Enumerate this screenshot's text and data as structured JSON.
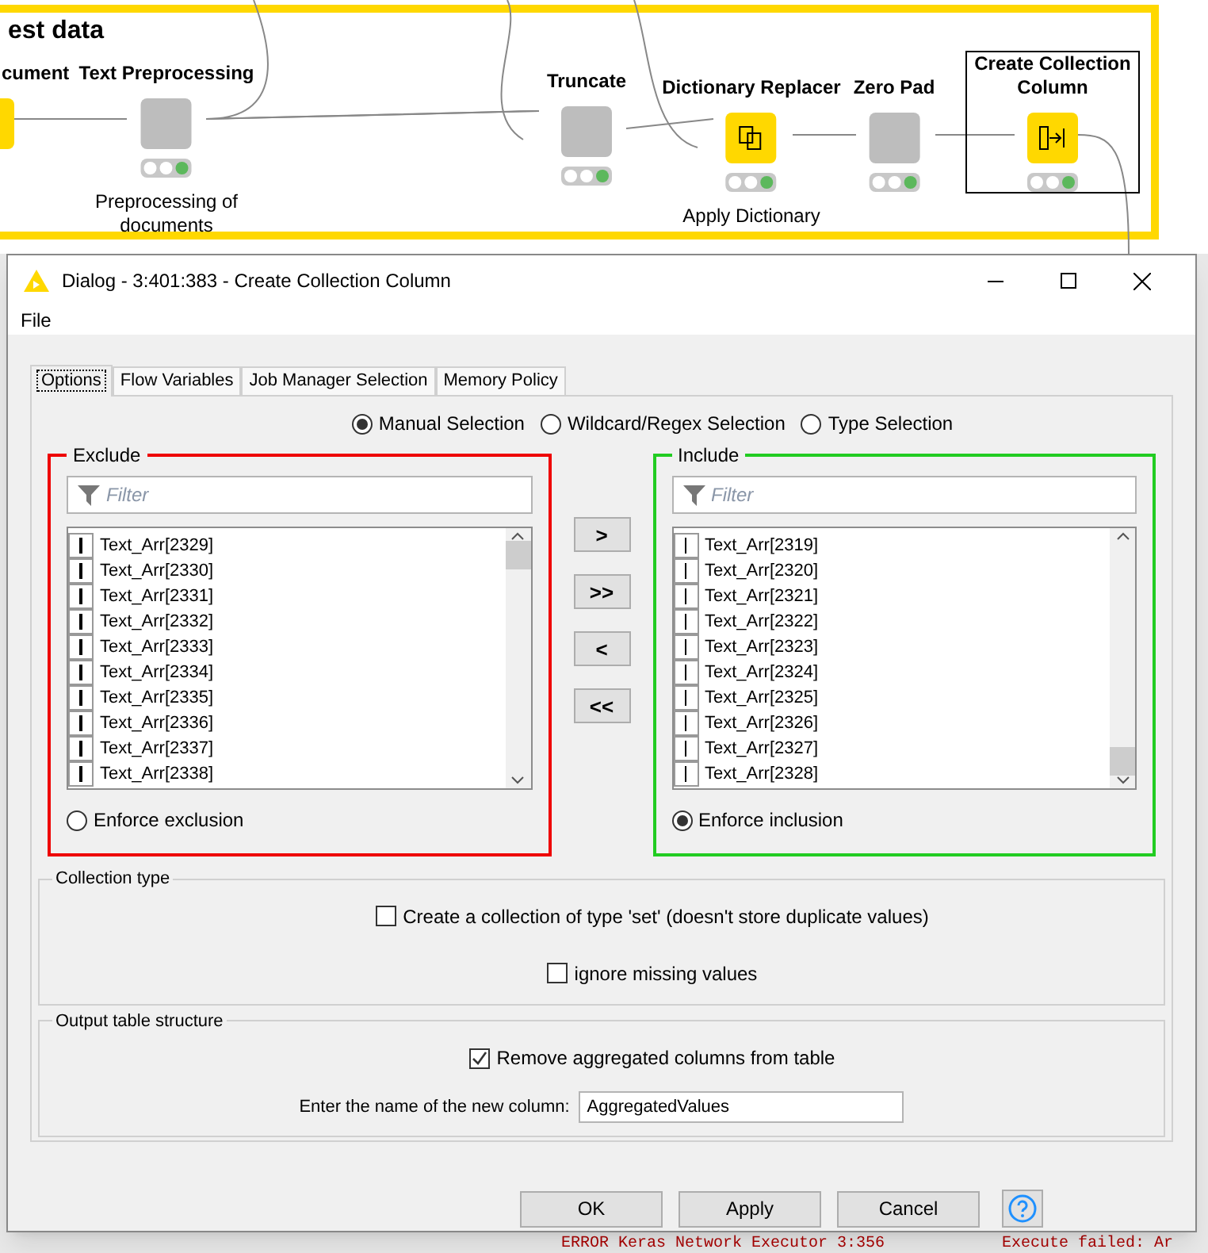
{
  "workflow": {
    "annotation_title": "est data",
    "nodes": [
      {
        "name": "cument",
        "color": "#ffd800",
        "selected": false
      },
      {
        "name": "Text Preprocessing",
        "color": "#bdbdbd",
        "selected": false,
        "annotation": "Preprocessing of documents"
      },
      {
        "name": "Truncate",
        "color": "#bdbdbd",
        "selected": false
      },
      {
        "name": "Dictionary Replacer",
        "color": "#ffd800",
        "selected": false,
        "annotation": "Apply Dictionary"
      },
      {
        "name": "Zero Pad",
        "color": "#bdbdbd",
        "selected": false
      },
      {
        "name": "Create Collection Column",
        "color": "#ffd800",
        "selected": true
      }
    ]
  },
  "dialog": {
    "title": "Dialog - 3:401:383 - Create Collection Column",
    "menu": [
      "File"
    ],
    "tabs": [
      {
        "label": "Options",
        "selected": true
      },
      {
        "label": "Flow Variables",
        "selected": false
      },
      {
        "label": "Job Manager Selection",
        "selected": false
      },
      {
        "label": "Memory Policy",
        "selected": false
      }
    ],
    "selection_modes": [
      {
        "label": "Manual Selection",
        "selected": true
      },
      {
        "label": "Wildcard/Regex Selection",
        "selected": false
      },
      {
        "label": "Type Selection",
        "selected": false
      }
    ],
    "exclude": {
      "title": "Exclude",
      "filter_placeholder": "Filter",
      "items": [
        "Text_Arr[2329]",
        "Text_Arr[2330]",
        "Text_Arr[2331]",
        "Text_Arr[2332]",
        "Text_Arr[2333]",
        "Text_Arr[2334]",
        "Text_Arr[2335]",
        "Text_Arr[2336]",
        "Text_Arr[2337]",
        "Text_Arr[2338]"
      ],
      "enforce": {
        "label": "Enforce exclusion",
        "selected": false
      }
    },
    "move_buttons": [
      ">",
      ">>",
      "<",
      "<<"
    ],
    "include": {
      "title": "Include",
      "filter_placeholder": "Filter",
      "items": [
        "Text_Arr[2319]",
        "Text_Arr[2320]",
        "Text_Arr[2321]",
        "Text_Arr[2322]",
        "Text_Arr[2323]",
        "Text_Arr[2324]",
        "Text_Arr[2325]",
        "Text_Arr[2326]",
        "Text_Arr[2327]",
        "Text_Arr[2328]"
      ],
      "enforce": {
        "label": "Enforce inclusion",
        "selected": true
      }
    },
    "collection_type": {
      "title": "Collection type",
      "options": [
        {
          "label": "Create a collection of type 'set' (doesn't store duplicate values)",
          "checked": false
        },
        {
          "label": "ignore missing values",
          "checked": false
        }
      ]
    },
    "output": {
      "title": "Output table structure",
      "options": [
        {
          "label": "Remove aggregated columns from table",
          "checked": true
        }
      ],
      "name_label": "Enter the name of the new column:",
      "name_value": "AggregatedValues"
    },
    "buttons": [
      "OK",
      "Apply",
      "Cancel"
    ]
  },
  "console": [
    "ERROR Keras Network Executor 3:356",
    "Execute failed: Ar"
  ]
}
